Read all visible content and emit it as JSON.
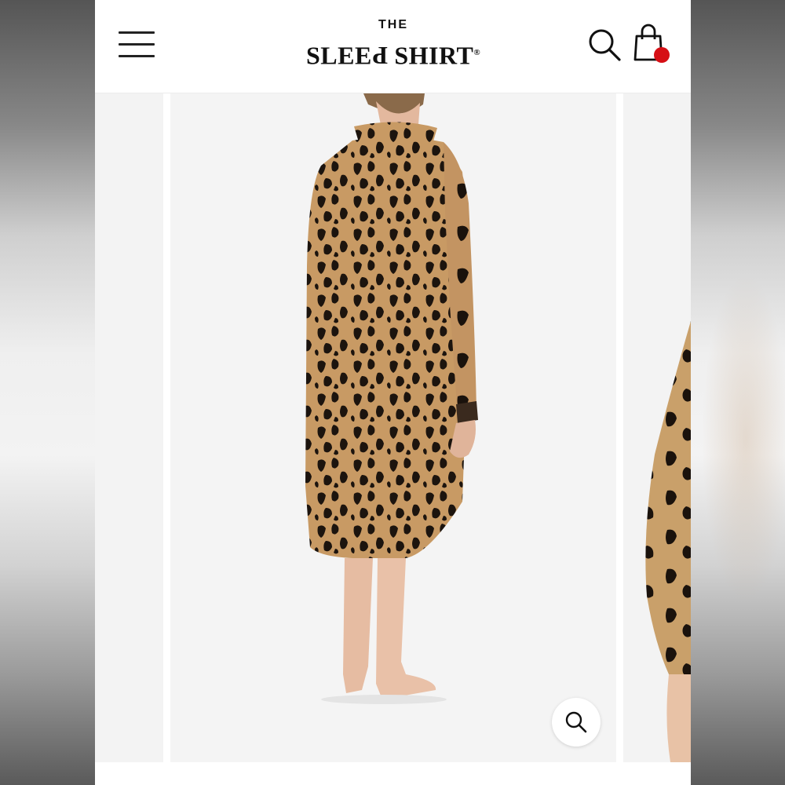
{
  "brand": {
    "logo_top": "THE",
    "logo_left": "SLEE",
    "logo_flipped": "P",
    "logo_right": "SHIRT",
    "registered": "®"
  },
  "header": {
    "menu_icon": "hamburger-menu-icon",
    "search_icon": "search-icon",
    "cart_icon": "shopping-bag-icon",
    "cart_badge_color": "#d60f15"
  },
  "gallery": {
    "main_image": "model wearing leopard print sleep shirt, back view",
    "next_image": "close-up of leopard print sleeve cuff",
    "zoom_icon": "zoom-icon"
  },
  "colors": {
    "print_base": "#c89a64",
    "print_spots": "#1c140e",
    "background": "#f4f4f4"
  }
}
